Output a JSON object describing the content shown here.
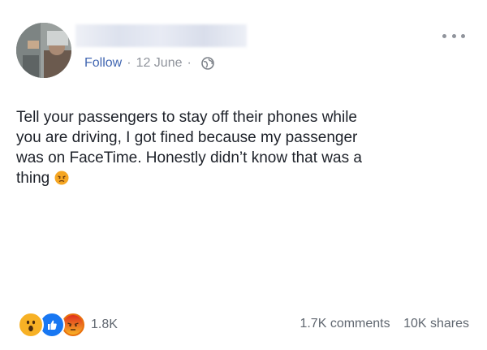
{
  "post": {
    "author_name": "",
    "follow_label": "Follow",
    "separator": "·",
    "date": "12 June",
    "audience_icon": "globe-icon",
    "more_icon": "more-options-icon",
    "text_lines": [
      "Tell your passengers to stay off their phones while",
      "you are driving, I got fined because my passenger",
      "was on FaceTime. Honestly didn’t know that was a",
      "thing"
    ],
    "text_emoji": "angry-face-emoji"
  },
  "reactions": {
    "icons": [
      "wow-reaction-icon",
      "like-reaction-icon",
      "angry-reaction-icon"
    ],
    "count": "1.8K"
  },
  "stats": {
    "comments": "1.7K comments",
    "shares": "10K shares"
  },
  "colors": {
    "link": "#4267b2",
    "meta": "#90949c",
    "text": "#1d2129",
    "like": "#1877f2",
    "wow": "#f7b125",
    "angry": "#e9710f"
  }
}
